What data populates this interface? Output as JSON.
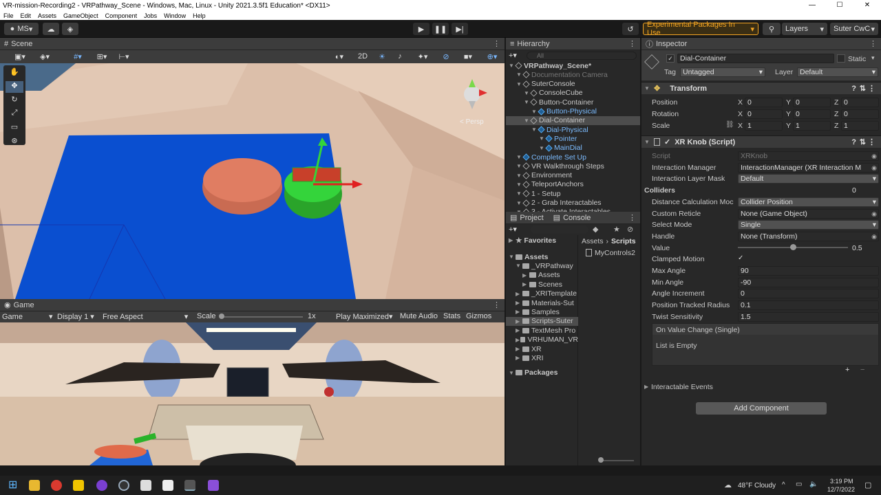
{
  "window": {
    "title": "VR-mission-Recording2 - VRPathway_Scene - Windows, Mac, Linux - Unity 2021.3.5f1 Education* <DX11>"
  },
  "menu": [
    "File",
    "Edit",
    "Assets",
    "GameObject",
    "Component",
    "Jobs",
    "Window",
    "Help"
  ],
  "toolbar": {
    "account": "MS",
    "packages": "Experimental Packages In Use",
    "layers": "Layers",
    "layout": "Suter CwC"
  },
  "scene": {
    "tab": "Scene",
    "mode_2d": "2D",
    "persp": "< Persp"
  },
  "game": {
    "tab": "Game",
    "display_select": "Game",
    "display": "Display 1",
    "aspect": "Free Aspect",
    "scale_label": "Scale",
    "scale_value": "1x",
    "play_mode": "Play Maximized",
    "mute": "Mute Audio",
    "stats": "Stats",
    "gizmos": "Gizmos"
  },
  "hierarchy": {
    "tab": "Hierarchy",
    "search_placeholder": "All",
    "items": [
      {
        "label": "VRPathway_Scene*",
        "depth": 0,
        "icon": "unity-scene-icon",
        "bold": true
      },
      {
        "label": "Documentation Camera",
        "depth": 1,
        "dim": true
      },
      {
        "label": "SuterConsole",
        "depth": 1
      },
      {
        "label": "ConsoleCube",
        "depth": 2
      },
      {
        "label": "Button-Container",
        "depth": 2
      },
      {
        "label": "Button-Physical",
        "depth": 3,
        "prefab": true
      },
      {
        "label": "Dial-Container",
        "depth": 2,
        "selected": true
      },
      {
        "label": "Dial-Physical",
        "depth": 3,
        "prefab": true
      },
      {
        "label": "Pointer",
        "depth": 4,
        "prefab": true
      },
      {
        "label": "MainDial",
        "depth": 4,
        "prefab": true
      },
      {
        "label": "Complete Set Up",
        "depth": 1,
        "prefab": true
      },
      {
        "label": "VR Walkthrough Steps",
        "depth": 1
      },
      {
        "label": "Environment",
        "depth": 1
      },
      {
        "label": "TeleportAnchors",
        "depth": 1
      },
      {
        "label": "1 - Setup",
        "depth": 1
      },
      {
        "label": "2 - Grab Interactables",
        "depth": 1
      },
      {
        "label": "3 - Activate Interactables",
        "depth": 1
      }
    ]
  },
  "project": {
    "tab_project": "Project",
    "tab_console": "Console",
    "favorites": "Favorites",
    "breadcrumb_root": "Assets",
    "breadcrumb_leaf": "Scripts",
    "file": "MyControls2",
    "tree": [
      {
        "label": "Assets",
        "depth": 0,
        "bold": true
      },
      {
        "label": "_VRPathway",
        "depth": 1
      },
      {
        "label": "Assets",
        "depth": 2
      },
      {
        "label": "Scenes",
        "depth": 2
      },
      {
        "label": "_XRITemplate",
        "depth": 1
      },
      {
        "label": "Materials-Sut",
        "depth": 1
      },
      {
        "label": "Samples",
        "depth": 1
      },
      {
        "label": "Scripts-Suter",
        "depth": 1,
        "selected": true
      },
      {
        "label": "TextMesh Pro",
        "depth": 1
      },
      {
        "label": "VRHUMAN_VR",
        "depth": 1
      },
      {
        "label": "XR",
        "depth": 1
      },
      {
        "label": "XRI",
        "depth": 1
      },
      {
        "label": "Packages",
        "depth": 0,
        "bold": true
      }
    ]
  },
  "inspector": {
    "tab": "Inspector",
    "object_name": "Dial-Container",
    "static": "Static",
    "tag_label": "Tag",
    "tag": "Untagged",
    "layer_label": "Layer",
    "layer": "Default",
    "transform": {
      "title": "Transform",
      "position": "Position",
      "rotation": "Rotation",
      "scale": "Scale",
      "pos": [
        "0",
        "0",
        "0"
      ],
      "rot": [
        "0",
        "0",
        "0"
      ],
      "scl": [
        "1",
        "1",
        "1"
      ]
    },
    "knob": {
      "title": "XR Knob (Script)",
      "rows": [
        {
          "label": "Script",
          "value": "XRKnob",
          "kind": "obj",
          "dim": true
        },
        {
          "label": "Interaction Manager",
          "value": "InteractionManager (XR Interaction M",
          "kind": "obj"
        },
        {
          "label": "Interaction Layer Mask",
          "value": "Default",
          "kind": "drop"
        },
        {
          "label": "Colliders",
          "value": "0",
          "kind": "count"
        },
        {
          "label": "Distance Calculation Moc",
          "value": "Collider Position",
          "kind": "drop"
        },
        {
          "label": "Custom Reticle",
          "value": "None (Game Object)",
          "kind": "obj"
        },
        {
          "label": "Select Mode",
          "value": "Single",
          "kind": "drop"
        },
        {
          "label": "Handle",
          "value": "None (Transform)",
          "kind": "obj"
        },
        {
          "label": "Value",
          "value": "0.5",
          "kind": "slider"
        },
        {
          "label": "Clamped Motion",
          "value": "✓",
          "kind": "check"
        },
        {
          "label": "Max Angle",
          "value": "90",
          "kind": "text"
        },
        {
          "label": "Min Angle",
          "value": "-90",
          "kind": "text"
        },
        {
          "label": "Angle Increment",
          "value": "0",
          "kind": "text"
        },
        {
          "label": "Position Tracked Radius",
          "value": "0.1",
          "kind": "text"
        },
        {
          "label": "Twist Sensitivity",
          "value": "1.5",
          "kind": "text"
        }
      ],
      "event_title": "On Value Change (Single)",
      "event_empty": "List is Empty",
      "events": "Interactable Events"
    },
    "add_component": "Add Component"
  },
  "taskbar": {
    "weather": "48°F Cloudy",
    "time": "3:19 PM",
    "date": "12/7/2022"
  }
}
